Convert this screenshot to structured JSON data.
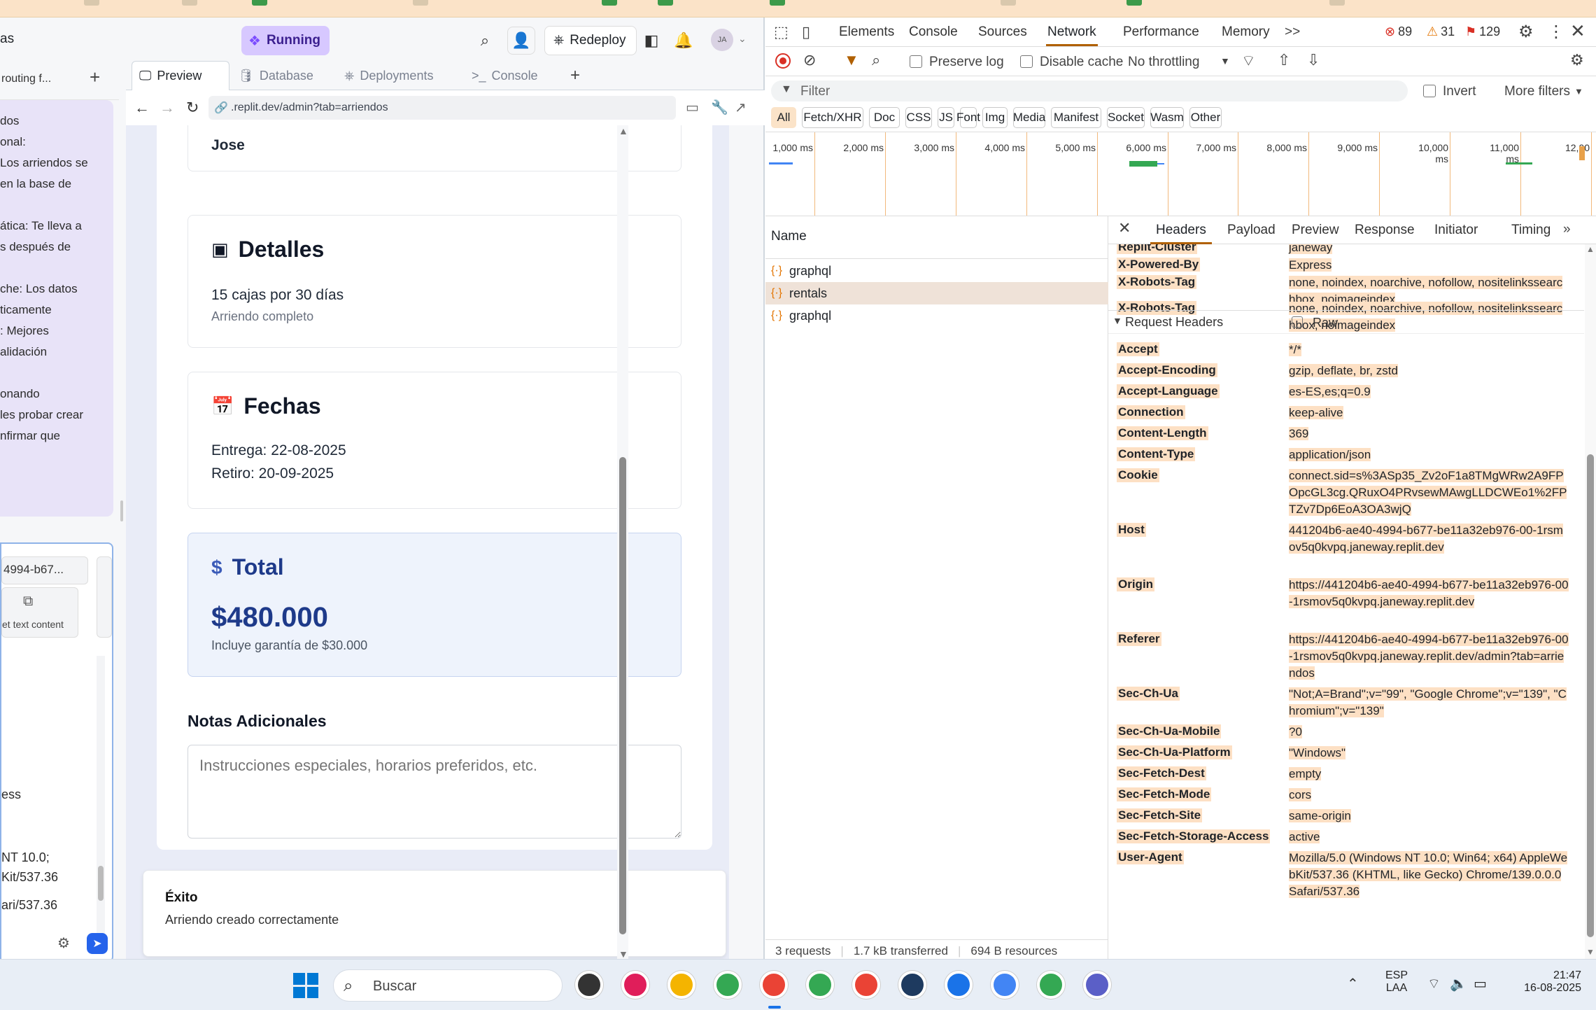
{
  "replit": {
    "workspace_title_fragment": "as",
    "status": "Running",
    "redeploy": "Redeploy",
    "avatar_initials": "JA",
    "tabs": [
      {
        "label": "Preview",
        "active": true
      },
      {
        "label": "Database"
      },
      {
        "label": "Deployments"
      },
      {
        "label": "Console"
      }
    ],
    "add_tab": "+",
    "url": ".replit.dev/admin?tab=arriendos",
    "chat": {
      "thread_title": "routing f...",
      "lines": [
        "dos",
        "onal:",
        "Los arriendos se",
        "en la base de",
        "",
        "ática: Te lleva a",
        "s después de",
        "",
        "che: Los datos",
        "ticamente",
        ": Mejores",
        "alidación",
        "",
        "onando",
        "les probar crear",
        "nfirmar que"
      ],
      "snippet_id": "4994-b67...",
      "snippet_action": "et text content",
      "ua_lines": [
        "ess",
        "",
        "",
        "NT 10.0;",
        "Kit/537.36",
        "",
        "ari/537.36"
      ]
    },
    "preview": {
      "client_name": "Jose",
      "details_title": "Detalles",
      "details_text": "15 cajas por 30 días",
      "details_sub": "Arriendo completo",
      "dates_title": "Fechas",
      "delivery": "Entrega: 22-08-2025",
      "pickup": "Retiro: 20-09-2025",
      "total_title": "Total",
      "total_amount": "$480.000",
      "total_note": "Incluye garantía de $30.000",
      "notes_title": "Notas Adicionales",
      "notes_placeholder": "Instrucciones especiales, horarios preferidos, etc.",
      "toast_title": "Éxito",
      "toast_msg": "Arriendo creado correctamente"
    }
  },
  "devtools": {
    "panels": [
      "Elements",
      "Console",
      "Sources",
      "Network",
      "Performance",
      "Memory"
    ],
    "active_panel": "Network",
    "more_panels": ">>",
    "errors": "89",
    "warnings": "31",
    "issues": "129",
    "preserve_log": "Preserve log",
    "disable_cache": "Disable cache",
    "throttling": "No throttling",
    "filter_placeholder": "Filter",
    "invert": "Invert",
    "more_filters": "More filters",
    "type_filters": [
      "All",
      "Fetch/XHR",
      "Doc",
      "CSS",
      "JS",
      "Font",
      "Img",
      "Media",
      "Manifest",
      "Socket",
      "Wasm",
      "Other"
    ],
    "timeline_labels": [
      "1,000 ms",
      "2,000 ms",
      "3,000 ms",
      "4,000 ms",
      "5,000 ms",
      "6,000 ms",
      "7,000 ms",
      "8,000 ms",
      "9,000 ms",
      "10,000 ms",
      "11,000 ms",
      "12,00"
    ],
    "name_col": "Name",
    "requests": [
      "graphql",
      "rentals",
      "graphql"
    ],
    "selected_request": "rentals",
    "detail_tabs": [
      "Headers",
      "Payload",
      "Preview",
      "Response",
      "Initiator",
      "Timing"
    ],
    "active_detail_tab": "Headers",
    "response_headers": [
      {
        "k": "Replit-Cluster",
        "v": "janeway"
      },
      {
        "k": "X-Powered-By",
        "v": "Express"
      },
      {
        "k": "X-Robots-Tag",
        "v": "none, noindex, noarchive, nofollow, nositelinkssearchbox, noimageindex"
      },
      {
        "k": "X-Robots-Tag",
        "v": "none, noindex, noarchive, nofollow, nositelinkssearchbox, noimageindex"
      }
    ],
    "request_headers_title": "Request Headers",
    "raw": "Raw",
    "request_headers": [
      {
        "k": "Accept",
        "v": "*/*"
      },
      {
        "k": "Accept-Encoding",
        "v": "gzip, deflate, br, zstd"
      },
      {
        "k": "Accept-Language",
        "v": "es-ES,es;q=0.9"
      },
      {
        "k": "Connection",
        "v": "keep-alive"
      },
      {
        "k": "Content-Length",
        "v": "369"
      },
      {
        "k": "Content-Type",
        "v": "application/json"
      },
      {
        "k": "Cookie",
        "v": "connect.sid=s%3ASp35_Zv2oF1a8TMgWRw2A9FPOpcGL3cg.QRuxO4PRvsewMAwgLLDCWEo1%2FPTZv7Dp6EoA3OA3wjQ"
      },
      {
        "k": "Host",
        "v": "441204b6-ae40-4994-b677-be11a32eb976-00-1rsmov5q0kvpq.janeway.replit.dev"
      },
      {
        "k": "Origin",
        "v": "https://441204b6-ae40-4994-b677-be11a32eb976-00-1rsmov5q0kvpq.janeway.replit.dev"
      },
      {
        "k": "Referer",
        "v": "https://441204b6-ae40-4994-b677-be11a32eb976-00-1rsmov5q0kvpq.janeway.replit.dev/admin?tab=arriendos"
      },
      {
        "k": "Sec-Ch-Ua",
        "v": "\"Not;A=Brand\";v=\"99\", \"Google Chrome\";v=\"139\", \"Chromium\";v=\"139\""
      },
      {
        "k": "Sec-Ch-Ua-Mobile",
        "v": "?0"
      },
      {
        "k": "Sec-Ch-Ua-Platform",
        "v": "\"Windows\""
      },
      {
        "k": "Sec-Fetch-Dest",
        "v": "empty"
      },
      {
        "k": "Sec-Fetch-Mode",
        "v": "cors"
      },
      {
        "k": "Sec-Fetch-Site",
        "v": "same-origin"
      },
      {
        "k": "Sec-Fetch-Storage-Access",
        "v": "active"
      },
      {
        "k": "User-Agent",
        "v": "Mozilla/5.0 (Windows NT 10.0; Win64; x64) AppleWebKit/537.36 (KHTML, like Gecko) Chrome/139.0.0.0 Safari/537.36"
      }
    ],
    "status_requests": "3 requests",
    "status_transferred": "1.7 kB transferred",
    "status_resources": "694 B resources"
  },
  "taskbar": {
    "search": "Buscar",
    "lang1": "ESP",
    "lang2": "LAA",
    "time": "21:47",
    "date": "16-08-2025"
  },
  "colors": {
    "accent_devtools": "#1a73e8",
    "highlight": "#fde0c4",
    "running_bg": "#d7c8ff",
    "total_blue": "#1e3a8a"
  }
}
